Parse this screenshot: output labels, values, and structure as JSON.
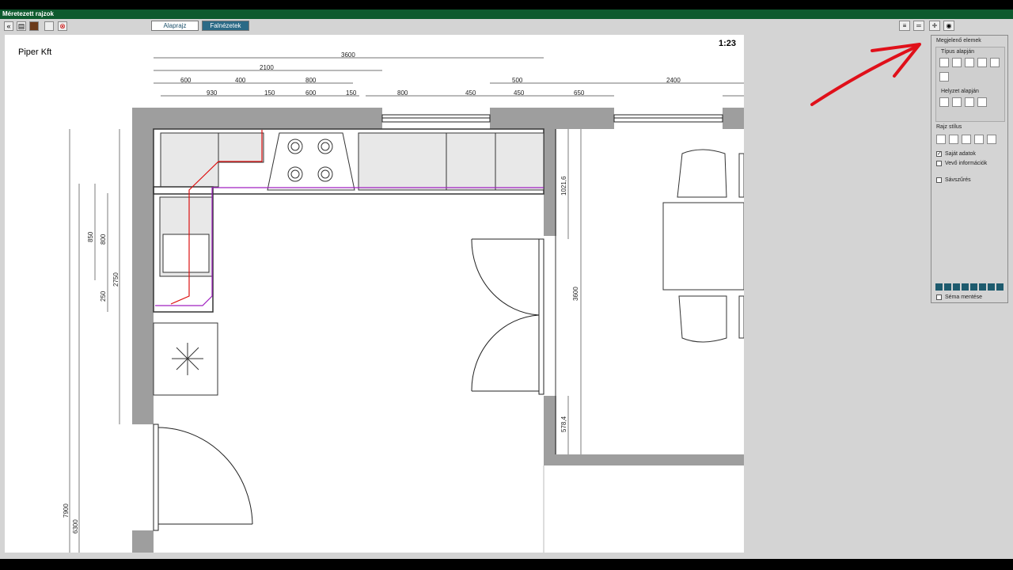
{
  "window": {
    "title": "Méretezett rajzok"
  },
  "toolbar": {
    "icons": [
      "back-icon",
      "print-icon",
      "save-icon",
      "blank-icon",
      "close-icon"
    ]
  },
  "tabs": [
    {
      "label": "Alaprajz"
    },
    {
      "label": "Falnézetek"
    }
  ],
  "drawing": {
    "company": "Piper Kft",
    "scale": "1:23",
    "dims_top": {
      "overall": "3600",
      "segment": "2100",
      "row3": [
        "600",
        "400",
        "800",
        "500",
        "2400"
      ],
      "row4": [
        "930",
        "150",
        "600",
        "150",
        "800",
        "450",
        "450",
        "650"
      ]
    },
    "dims_left": [
      "850",
      "800",
      "2750",
      "250",
      "7900",
      "6300"
    ],
    "dims_right": [
      "1021,6",
      "3600",
      "578,4"
    ]
  },
  "panel": {
    "title": "Megjelenő elemek",
    "type_group": "Típus alapján",
    "position_group": "Helyzet alapján",
    "style_group": "Rajz stílus",
    "checks": [
      {
        "label": "Saját adatok",
        "checked": true
      },
      {
        "label": "Vevő információk",
        "checked": false
      },
      {
        "label": "Sávszűrés",
        "checked": false
      }
    ],
    "save_schema": "Séma mentése"
  },
  "colors": {
    "titlebar": "#0d5a2e",
    "accent": "#2b6a86",
    "wall": "#9e9e9e",
    "annotation": "#e0101a"
  }
}
